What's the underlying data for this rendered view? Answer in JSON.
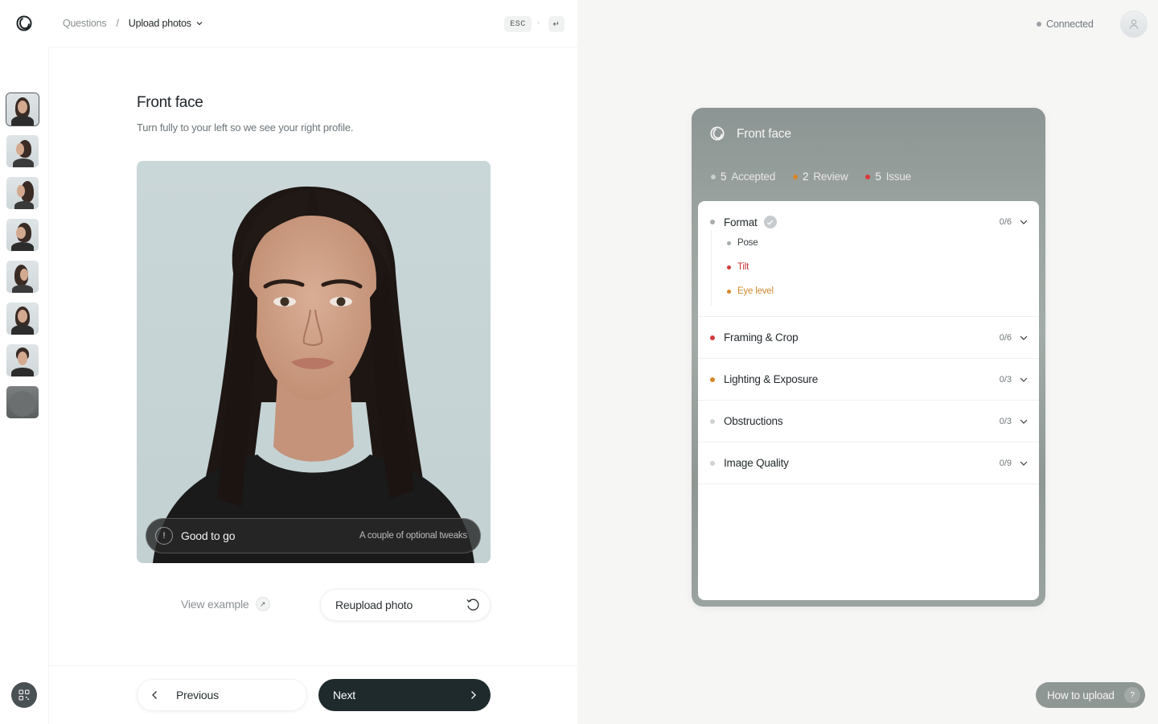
{
  "header": {
    "breadcrumb_root": "Questions",
    "breadcrumb_sep": "/",
    "breadcrumb_current": "Upload photos",
    "kbd_esc": "ESC",
    "kbd_dot": "·",
    "kbd_enter": "↵",
    "connection_status": "Connected"
  },
  "sidebar": {
    "thumbnails": [
      "front-face",
      "right-profile",
      "right-side",
      "three-quarter-left",
      "left-side",
      "smile",
      "chin-up",
      "top-of-head"
    ]
  },
  "main": {
    "title": "Front face",
    "subtitle": "Turn fully to your left so we see your right profile.",
    "status_icon": "!",
    "status_label": "Good to go",
    "status_hint": "A couple of optional tweaks",
    "view_example": "View example",
    "view_example_icon": "↗",
    "reupload": "Reupload photo"
  },
  "footer": {
    "previous": "Previous",
    "next": "Next"
  },
  "card": {
    "title": "Front face",
    "counts": [
      {
        "num": "5",
        "label": "Accepted",
        "color": "#c9cfcf"
      },
      {
        "num": "2",
        "label": "Review",
        "color": "#d9862a"
      },
      {
        "num": "5",
        "label": "Issue",
        "color": "#d93a3a"
      }
    ],
    "sections": [
      {
        "label": "Format",
        "count": "0/6",
        "color": "#a7acae",
        "expanded": true
      },
      {
        "label": "Framing & Crop",
        "count": "0/6",
        "color": "#d23b3b"
      },
      {
        "label": "Lighting & Exposure",
        "count": "0/3",
        "color": "#d9862a"
      },
      {
        "label": "Obstructions",
        "count": "0/3",
        "color": "#cfd3d4"
      },
      {
        "label": "Image Quality",
        "count": "0/9",
        "color": "#cfd3d4"
      }
    ],
    "format_items": [
      {
        "label": "Pose",
        "color": "#a7acae",
        "text_color": "#3a4043"
      },
      {
        "label": "Tilt",
        "color": "#d23b3b",
        "text_color": "#c43434"
      },
      {
        "label": "Eye level",
        "color": "#d9862a",
        "text_color": "#d0892f"
      }
    ]
  },
  "help": {
    "label": "How to upload",
    "icon": "?"
  }
}
